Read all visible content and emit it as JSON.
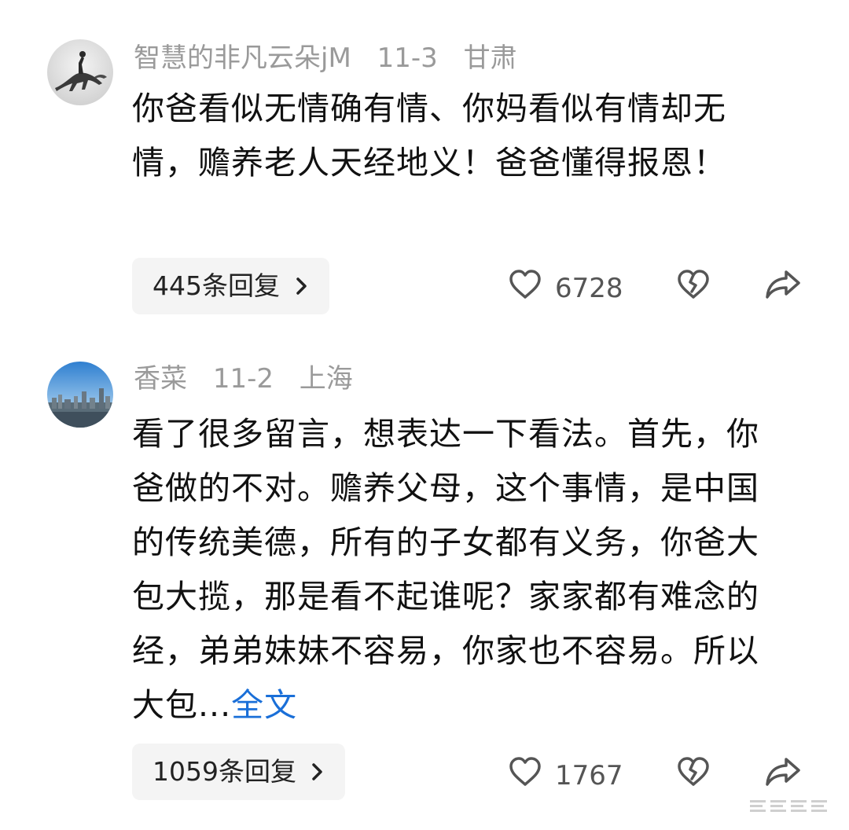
{
  "comments": [
    {
      "username": "智慧的非凡云朵jM",
      "date": "11-3",
      "location": "甘肃",
      "text": "你爸看似无情确有情、你妈看似有情却无情，赡养老人天经地义！爸爸懂得报恩！",
      "more_link": "",
      "replies_label": "445条回复",
      "likes": "6728",
      "avatar_icon": "rider-on-horse-avatar",
      "icons": [
        "heart-icon",
        "broken-heart-icon",
        "share-icon"
      ]
    },
    {
      "username": "香菜",
      "date": "11-2",
      "location": "上海",
      "text": "看了很多留言，想表达一下看法。首先，你爸做的不对。赡养父母，这个事情，是中国的传统美德，所有的子女都有义务，你爸大包大揽，那是看不起谁呢？家家都有难念的经，弟弟妹妹不容易，你家也不容易。所以大包...",
      "more_link": "全文",
      "replies_label": "1059条回复",
      "likes": "1767",
      "avatar_icon": "city-skyline-avatar",
      "icons": [
        "heart-icon",
        "broken-heart-icon",
        "share-icon"
      ]
    }
  ],
  "colors": {
    "meta_text": "#9a9a9a",
    "body_text": "#111111",
    "link": "#1a6fd8",
    "reply_bg": "#f4f4f4",
    "icon": "#555555"
  }
}
